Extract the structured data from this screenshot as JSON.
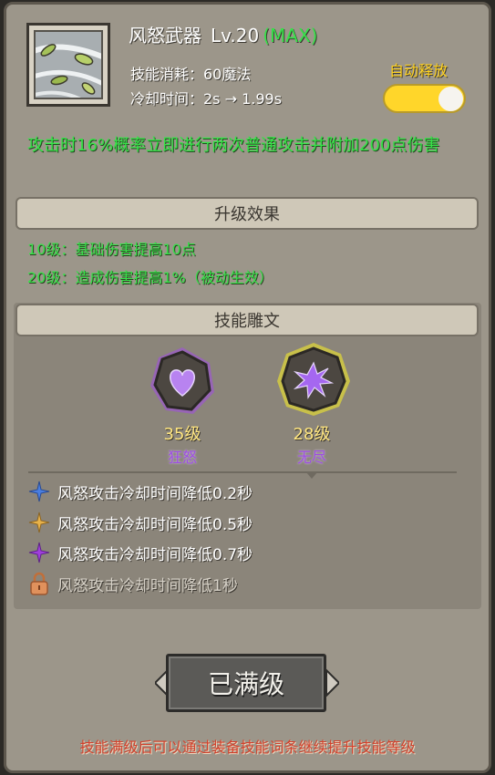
{
  "skill": {
    "name": "风怒武器",
    "level": "Lv.20",
    "max_tag": "(MAX)",
    "cost": "技能消耗：60魔法",
    "cooldown": "冷却时间：2s → 1.99s",
    "auto_cast_label": "自动释放",
    "auto_cast_on": true,
    "description": "攻击时16%概率立即进行两次普通攻击并附加200点伤害"
  },
  "upgrade": {
    "header": "升级效果",
    "items": [
      "10级：基础伤害提高10点",
      "20级：造成伤害提高1%（被动生效）"
    ]
  },
  "runes": {
    "header": "技能雕文",
    "slots": [
      {
        "level": "35级",
        "name": "狂怒",
        "icon": "heart-rune-icon",
        "glow": "#a24ae6"
      },
      {
        "level": "28级",
        "name": "无尽",
        "icon": "burst-rune-icon",
        "glow": "#f1e82a"
      }
    ],
    "effects": [
      {
        "text": "风怒攻击冷却时间降低0.2秒",
        "icon": "blue-star-icon",
        "color": "#3f73d8",
        "locked": false
      },
      {
        "text": "风怒攻击冷却时间降低0.5秒",
        "icon": "gold-star-icon",
        "color": "#e0aa3c",
        "locked": false
      },
      {
        "text": "风怒攻击冷却时间降低0.7秒",
        "icon": "purple-star-icon",
        "color": "#9a3bd6",
        "locked": false
      },
      {
        "text": "风怒攻击冷却时间降低1秒",
        "icon": "lock-icon",
        "color": "#e0915c",
        "locked": true
      }
    ]
  },
  "button": {
    "label": "已满级"
  },
  "footer": "技能满级后可以通过装备技能词条继续提升技能等级"
}
